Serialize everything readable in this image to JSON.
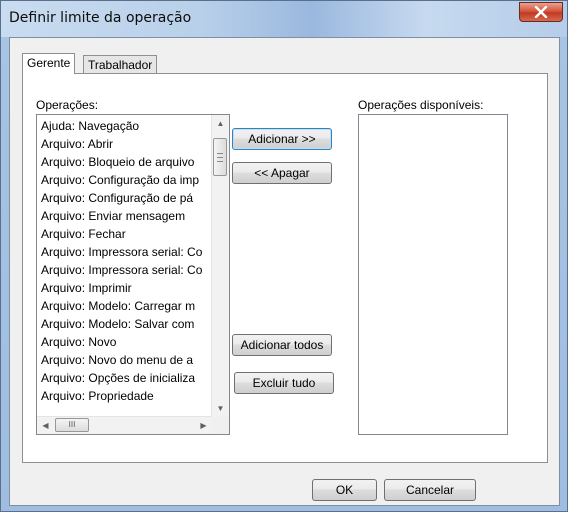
{
  "window": {
    "title": "Definir limite da operação"
  },
  "tabs": [
    {
      "label": "Gerente",
      "active": true
    },
    {
      "label": "Trabalhador",
      "active": false
    }
  ],
  "operations": {
    "label": "Operações:",
    "items": [
      "Ajuda: Navegação",
      "Arquivo: Abrir",
      "Arquivo: Bloqueio de arquivo",
      "Arquivo: Configuração da imp",
      "Arquivo: Configuração de pá",
      "Arquivo: Enviar mensagem",
      "Arquivo: Fechar",
      "Arquivo: Impressora serial: Co",
      "Arquivo: Impressora serial: Co",
      "Arquivo: Imprimir",
      "Arquivo: Modelo: Carregar m",
      "Arquivo: Modelo: Salvar com",
      "Arquivo: Novo",
      "Arquivo: Novo do menu de a",
      "Arquivo: Opções de inicializa",
      "Arquivo: Propriedade"
    ]
  },
  "available": {
    "label": "Operações disponíveis:",
    "items": []
  },
  "buttons": {
    "add": "Adicionar >>",
    "remove": "<< Apagar",
    "add_all": "Adicionar todos",
    "remove_all": "Excluir tudo",
    "ok": "OK",
    "cancel": "Cancelar"
  },
  "icons": {
    "close": "close-icon",
    "scroll_up": "scroll-up-arrow-icon",
    "scroll_down": "scroll-down-arrow-icon",
    "scroll_left": "scroll-left-arrow-icon",
    "scroll_right": "scroll-right-arrow-icon"
  },
  "colors": {
    "close_button": "#c9442b",
    "default_button_border": "#3c7fb1",
    "panel": "#ffffff",
    "dialog": "#f0f0f0"
  }
}
